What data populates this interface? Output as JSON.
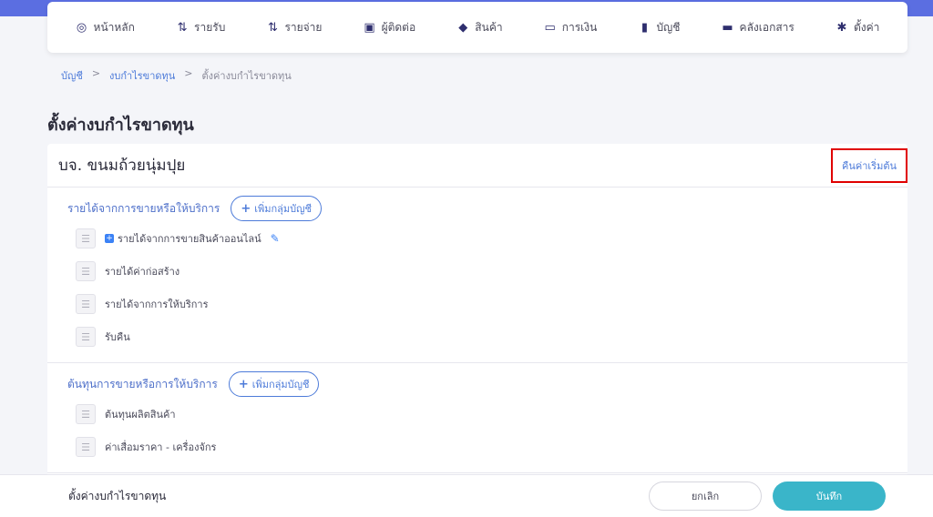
{
  "nav": [
    {
      "label": "หน้าหลัก",
      "icon": "dashboard-icon",
      "glyph": "◎"
    },
    {
      "label": "รายรับ",
      "icon": "income-icon",
      "glyph": "⇅"
    },
    {
      "label": "รายจ่าย",
      "icon": "expense-icon",
      "glyph": "⇅"
    },
    {
      "label": "ผู้ติดต่อ",
      "icon": "contacts-icon",
      "glyph": "▣"
    },
    {
      "label": "สินค้า",
      "icon": "product-box-icon",
      "glyph": "◆"
    },
    {
      "label": "การเงิน",
      "icon": "money-icon",
      "glyph": "▭"
    },
    {
      "label": "บัญชี",
      "icon": "ledger-book-icon",
      "glyph": "▮"
    },
    {
      "label": "คลังเอกสาร",
      "icon": "folder-icon",
      "glyph": "▬"
    },
    {
      "label": "ตั้งค่า",
      "icon": "gear-icon",
      "glyph": "✱"
    }
  ],
  "breadcrumb": {
    "item1": "บัญชี",
    "item2": "งบกำไรขาดทุน",
    "current": "ตั้งค่างบกำไรขาดทุน",
    "separator": ">"
  },
  "page_title": "ตั้งค่างบกำไรขาดทุน",
  "card": {
    "company_name": "บจ. ขนมถ้วยนุ่มปุย",
    "reset_label": "คืนค่าเริ่มต้น"
  },
  "add_group_label": "เพิ่มกลุ่มบัญชี",
  "sections": [
    {
      "title": "รายได้จากการขายหรือให้บริการ",
      "items": [
        "รายได้จากการขายสินค้าออนไลน์",
        "รายได้ค่าก่อสร้าง",
        "รายได้จากการให้บริการ",
        "รับคืน"
      ]
    },
    {
      "title": "ต้นทุนการขายหรือการให้บริการ",
      "items": [
        "ต้นทุนผลิตสินค้า",
        "ค่าเสื่อมราคา - เครื่องจักร"
      ]
    }
  ],
  "footer": {
    "title": "ตั้งค่างบกำไรขาดทุน",
    "cancel_label": "ยกเลิก",
    "save_label": "บันทึก"
  },
  "colors": {
    "accent_blue": "#4d7bd9",
    "save_button": "#3ab5c9",
    "highlight_box": "#e00000"
  }
}
